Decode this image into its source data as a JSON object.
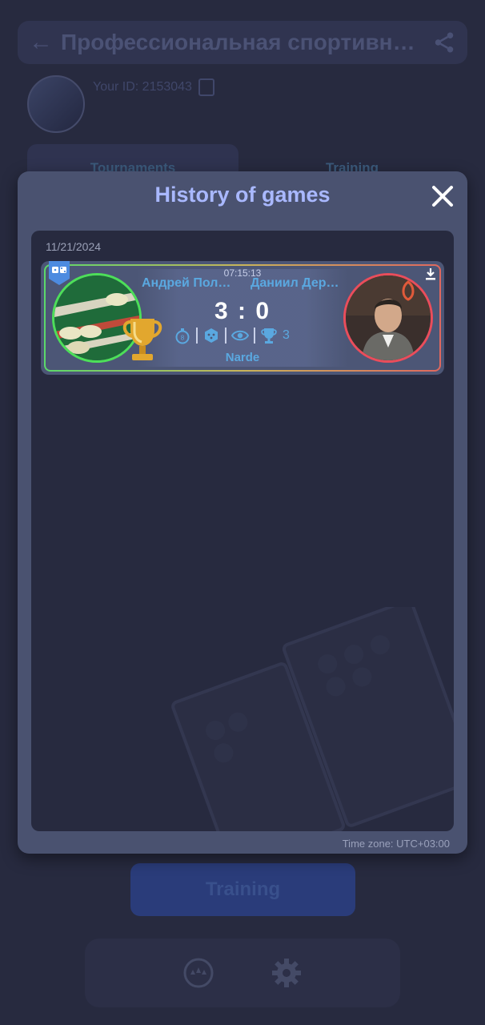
{
  "background": {
    "header_title": "Профессиональная спортивн…",
    "user_id": "Your ID: 2153043",
    "tabs": [
      "Tournaments",
      "Training"
    ],
    "training_button": "Training"
  },
  "modal": {
    "title": "History of games",
    "date": "11/21/2024",
    "time_zone": "Time zone: UTC+03:00",
    "game": {
      "time": "07:15:13",
      "player1": "Андрей Пол…",
      "player2": "Даниил Дер…",
      "score": "3 : 0",
      "trophy_count": "3",
      "game_type": "Narde",
      "winner_border_color": "#4ddf59",
      "loser_border_color": "#ea4d5b"
    }
  },
  "colors": {
    "accent": "#a9b8ff",
    "link": "#5aa8e0",
    "modal_bg": "#4a5270",
    "page_bg": "#272a3f"
  }
}
